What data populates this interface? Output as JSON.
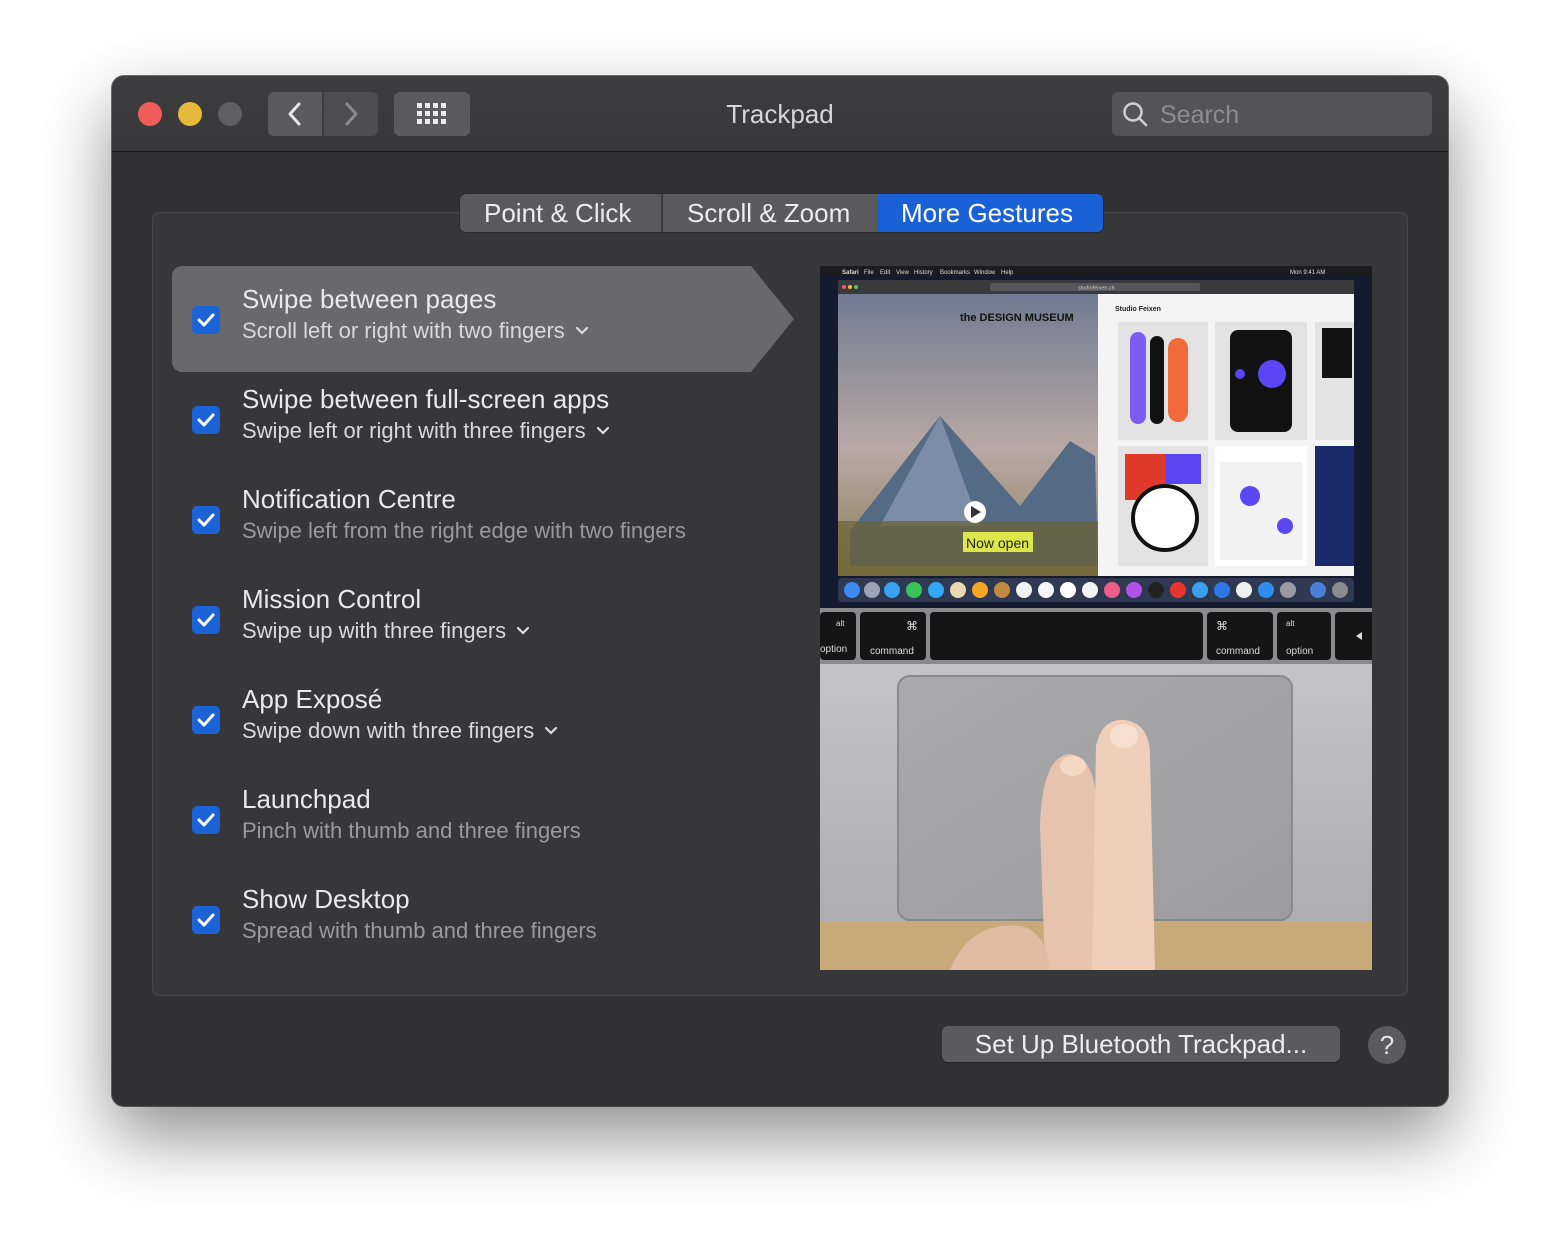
{
  "window": {
    "title": "Trackpad"
  },
  "toolbar": {
    "search_placeholder": "Search"
  },
  "tabs": [
    {
      "label": "Point & Click",
      "active": false
    },
    {
      "label": "Scroll & Zoom",
      "active": false
    },
    {
      "label": "More Gestures",
      "active": true
    }
  ],
  "gestures": [
    {
      "title": "Swipe between pages",
      "subtitle": "Scroll left or right with two fingers",
      "has_menu": true,
      "checked": true,
      "selected": true
    },
    {
      "title": "Swipe between full-screen apps",
      "subtitle": "Swipe left or right with three fingers",
      "has_menu": true,
      "checked": true
    },
    {
      "title": "Notification Centre",
      "subtitle": "Swipe left from the right edge with two fingers",
      "has_menu": false,
      "checked": true
    },
    {
      "title": "Mission Control",
      "subtitle": "Swipe up with three fingers",
      "has_menu": true,
      "checked": true
    },
    {
      "title": "App Exposé",
      "subtitle": "Swipe down with three fingers",
      "has_menu": true,
      "checked": true
    },
    {
      "title": "Launchpad",
      "subtitle": "Pinch with thumb and three fingers",
      "has_menu": false,
      "checked": true
    },
    {
      "title": "Show Desktop",
      "subtitle": "Spread with thumb and three fingers",
      "has_menu": false,
      "checked": true
    }
  ],
  "preview": {
    "menubar": [
      "Safari",
      "File",
      "Edit",
      "View",
      "History",
      "Bookmarks",
      "Window",
      "Help"
    ],
    "clock": "Mon 9:41 AM",
    "url": "studiofeixen.ch",
    "left_site": "the DESIGN MUSEUM",
    "now_open": "Now open",
    "right_site": "Studio Feixen",
    "keys": [
      {
        "top": "alt",
        "bottom": "option"
      },
      {
        "top": "⌘",
        "bottom": "command"
      },
      {
        "top": "⌘",
        "bottom": "command"
      },
      {
        "top": "alt",
        "bottom": "option"
      }
    ]
  },
  "buttons": {
    "setup": "Set Up Bluetooth Trackpad...",
    "help": "?"
  },
  "colors": {
    "accent": "#1a60d6",
    "window_bg": "#313134",
    "close": "#ee5d58",
    "minimize": "#e7b93a"
  }
}
